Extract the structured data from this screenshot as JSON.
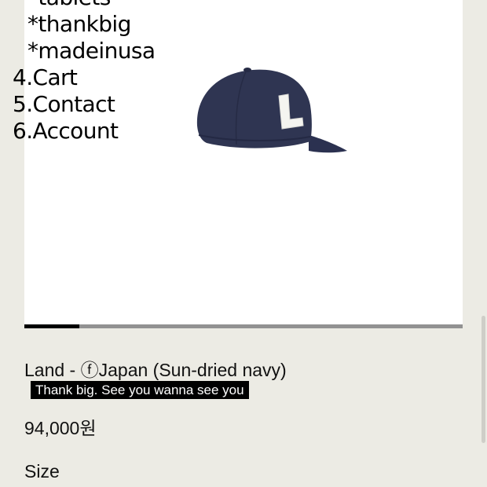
{
  "menu": {
    "sub_items": [
      "*tablets",
      "*thankbig",
      "*madeinusa"
    ],
    "items": [
      "4.Cart",
      "5.Contact",
      "6.Account"
    ]
  },
  "gallery": {
    "image_letter": "L",
    "cap_color": "#2f3552",
    "progress": 0.125
  },
  "product": {
    "title": "Land - ⓕJapan (Sun-dried navy)",
    "tagline": "Thank big. See you wanna see you",
    "price": "94,000원",
    "size_label": "Size"
  }
}
